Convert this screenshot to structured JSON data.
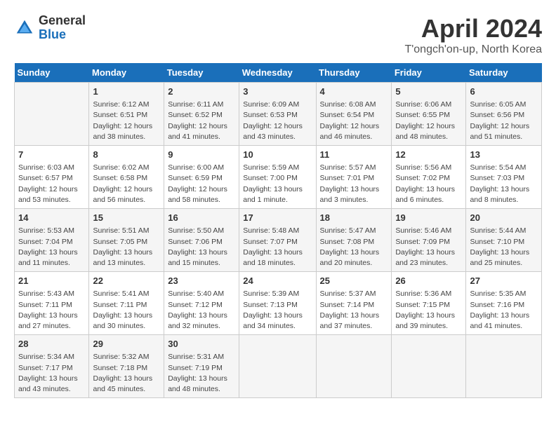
{
  "header": {
    "logo_general": "General",
    "logo_blue": "Blue",
    "month_title": "April 2024",
    "location": "T'ongch'on-up, North Korea"
  },
  "weekdays": [
    "Sunday",
    "Monday",
    "Tuesday",
    "Wednesday",
    "Thursday",
    "Friday",
    "Saturday"
  ],
  "weeks": [
    [
      {
        "day": "",
        "info": ""
      },
      {
        "day": "1",
        "info": "Sunrise: 6:12 AM\nSunset: 6:51 PM\nDaylight: 12 hours\nand 38 minutes."
      },
      {
        "day": "2",
        "info": "Sunrise: 6:11 AM\nSunset: 6:52 PM\nDaylight: 12 hours\nand 41 minutes."
      },
      {
        "day": "3",
        "info": "Sunrise: 6:09 AM\nSunset: 6:53 PM\nDaylight: 12 hours\nand 43 minutes."
      },
      {
        "day": "4",
        "info": "Sunrise: 6:08 AM\nSunset: 6:54 PM\nDaylight: 12 hours\nand 46 minutes."
      },
      {
        "day": "5",
        "info": "Sunrise: 6:06 AM\nSunset: 6:55 PM\nDaylight: 12 hours\nand 48 minutes."
      },
      {
        "day": "6",
        "info": "Sunrise: 6:05 AM\nSunset: 6:56 PM\nDaylight: 12 hours\nand 51 minutes."
      }
    ],
    [
      {
        "day": "7",
        "info": "Sunrise: 6:03 AM\nSunset: 6:57 PM\nDaylight: 12 hours\nand 53 minutes."
      },
      {
        "day": "8",
        "info": "Sunrise: 6:02 AM\nSunset: 6:58 PM\nDaylight: 12 hours\nand 56 minutes."
      },
      {
        "day": "9",
        "info": "Sunrise: 6:00 AM\nSunset: 6:59 PM\nDaylight: 12 hours\nand 58 minutes."
      },
      {
        "day": "10",
        "info": "Sunrise: 5:59 AM\nSunset: 7:00 PM\nDaylight: 13 hours\nand 1 minute."
      },
      {
        "day": "11",
        "info": "Sunrise: 5:57 AM\nSunset: 7:01 PM\nDaylight: 13 hours\nand 3 minutes."
      },
      {
        "day": "12",
        "info": "Sunrise: 5:56 AM\nSunset: 7:02 PM\nDaylight: 13 hours\nand 6 minutes."
      },
      {
        "day": "13",
        "info": "Sunrise: 5:54 AM\nSunset: 7:03 PM\nDaylight: 13 hours\nand 8 minutes."
      }
    ],
    [
      {
        "day": "14",
        "info": "Sunrise: 5:53 AM\nSunset: 7:04 PM\nDaylight: 13 hours\nand 11 minutes."
      },
      {
        "day": "15",
        "info": "Sunrise: 5:51 AM\nSunset: 7:05 PM\nDaylight: 13 hours\nand 13 minutes."
      },
      {
        "day": "16",
        "info": "Sunrise: 5:50 AM\nSunset: 7:06 PM\nDaylight: 13 hours\nand 15 minutes."
      },
      {
        "day": "17",
        "info": "Sunrise: 5:48 AM\nSunset: 7:07 PM\nDaylight: 13 hours\nand 18 minutes."
      },
      {
        "day": "18",
        "info": "Sunrise: 5:47 AM\nSunset: 7:08 PM\nDaylight: 13 hours\nand 20 minutes."
      },
      {
        "day": "19",
        "info": "Sunrise: 5:46 AM\nSunset: 7:09 PM\nDaylight: 13 hours\nand 23 minutes."
      },
      {
        "day": "20",
        "info": "Sunrise: 5:44 AM\nSunset: 7:10 PM\nDaylight: 13 hours\nand 25 minutes."
      }
    ],
    [
      {
        "day": "21",
        "info": "Sunrise: 5:43 AM\nSunset: 7:11 PM\nDaylight: 13 hours\nand 27 minutes."
      },
      {
        "day": "22",
        "info": "Sunrise: 5:41 AM\nSunset: 7:11 PM\nDaylight: 13 hours\nand 30 minutes."
      },
      {
        "day": "23",
        "info": "Sunrise: 5:40 AM\nSunset: 7:12 PM\nDaylight: 13 hours\nand 32 minutes."
      },
      {
        "day": "24",
        "info": "Sunrise: 5:39 AM\nSunset: 7:13 PM\nDaylight: 13 hours\nand 34 minutes."
      },
      {
        "day": "25",
        "info": "Sunrise: 5:37 AM\nSunset: 7:14 PM\nDaylight: 13 hours\nand 37 minutes."
      },
      {
        "day": "26",
        "info": "Sunrise: 5:36 AM\nSunset: 7:15 PM\nDaylight: 13 hours\nand 39 minutes."
      },
      {
        "day": "27",
        "info": "Sunrise: 5:35 AM\nSunset: 7:16 PM\nDaylight: 13 hours\nand 41 minutes."
      }
    ],
    [
      {
        "day": "28",
        "info": "Sunrise: 5:34 AM\nSunset: 7:17 PM\nDaylight: 13 hours\nand 43 minutes."
      },
      {
        "day": "29",
        "info": "Sunrise: 5:32 AM\nSunset: 7:18 PM\nDaylight: 13 hours\nand 45 minutes."
      },
      {
        "day": "30",
        "info": "Sunrise: 5:31 AM\nSunset: 7:19 PM\nDaylight: 13 hours\nand 48 minutes."
      },
      {
        "day": "",
        "info": ""
      },
      {
        "day": "",
        "info": ""
      },
      {
        "day": "",
        "info": ""
      },
      {
        "day": "",
        "info": ""
      }
    ]
  ]
}
